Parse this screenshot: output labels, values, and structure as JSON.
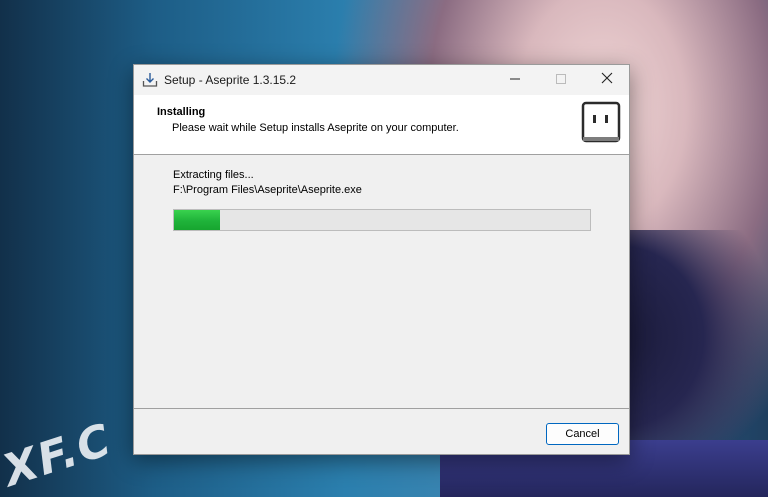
{
  "window": {
    "title": "Setup - Aseprite 1.3.15.2",
    "minimize_icon": "minimize-icon",
    "maximize_icon": "maximize-icon",
    "close_icon": "close-icon",
    "title_icon": "download-tray-icon"
  },
  "header": {
    "title": "Installing",
    "subtitle": "Please wait while Setup installs Aseprite on your computer.",
    "logo_icon": "aseprite-logo-icon"
  },
  "body": {
    "status_line": "Extracting files...",
    "current_file": "F:\\Program Files\\Aseprite\\Aseprite.exe",
    "progress_fraction": 0.11,
    "progress_color": "#1fb33a"
  },
  "footer": {
    "cancel_label": "Cancel",
    "accent": "#0067c0"
  },
  "wallpaper": {
    "mark_text": "XF.C"
  }
}
